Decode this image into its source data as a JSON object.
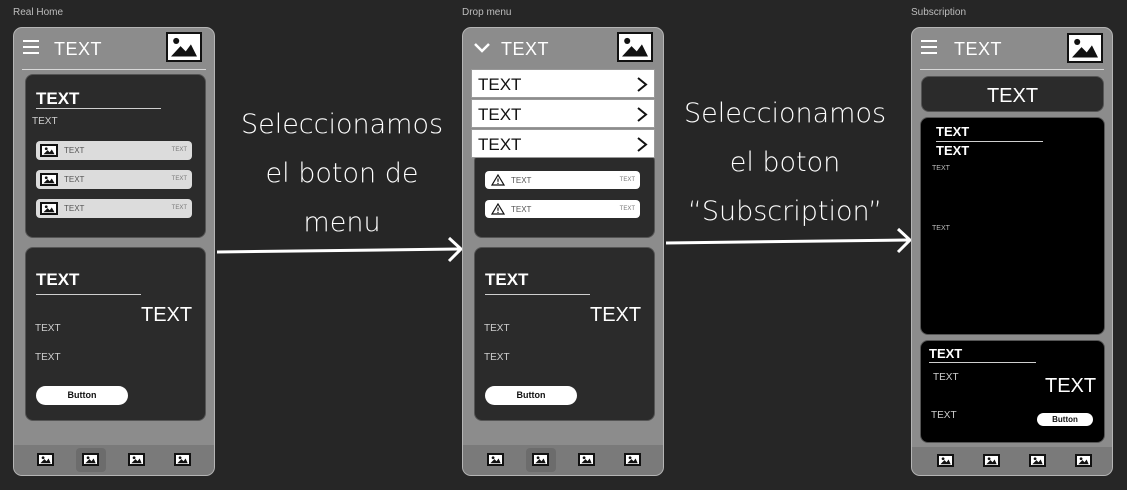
{
  "frames": {
    "real_home": {
      "label": "Real Home"
    },
    "drop_menu": {
      "label": "Drop menu"
    },
    "subscription": {
      "label": "Subscription"
    }
  },
  "common": {
    "header_title": "TEXT",
    "text": "TEXT",
    "button": "Button"
  },
  "steps": {
    "first": {
      "line1": "Seleccionamos",
      "line2": "el boton de",
      "line3": "menu"
    },
    "second": {
      "line1": "Seleccionamos",
      "line2": "el boton",
      "line3": "“Subscription”"
    }
  },
  "icons": {
    "menu": "hamburger-icon",
    "collapse": "chevron-down-icon",
    "image": "image-icon",
    "warning": "warning-icon",
    "next": "chevron-right-icon",
    "flow": "arrow-right-icon"
  }
}
